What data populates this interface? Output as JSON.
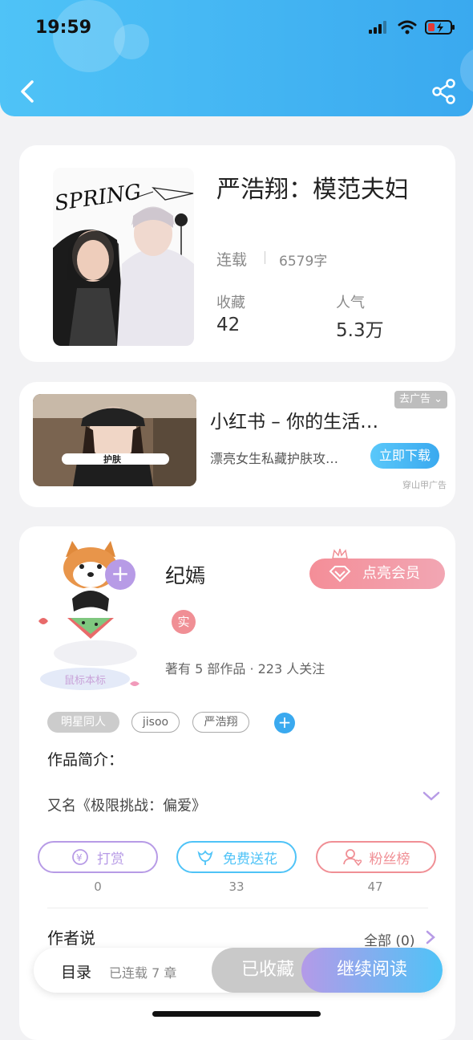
{
  "status_bar": {
    "time": "19:59"
  },
  "book": {
    "title": "严浩翔：模范夫妇",
    "status": "连载",
    "word_count": "6579字",
    "favorites_label": "收藏",
    "favorites_value": "42",
    "popularity_label": "人气",
    "popularity_value": "5.3万",
    "cover_text": "SPRING"
  },
  "ad": {
    "title": "小红书 – 你的生活…",
    "description": "漂亮女生私藏护肤攻…",
    "close_label": "去广告",
    "cta_label": "立即下载",
    "source": "穿山甲广告",
    "image_text": "护肤"
  },
  "author": {
    "name": "纪嫣",
    "vip_label": "点亮会员",
    "verified_label": "实",
    "meta": "著有 5 部作品 · 223 人关注",
    "avatar_badge": "鼠标本标",
    "tags": [
      "明星同人",
      "jisoo",
      "严浩翔"
    ],
    "intro_label": "作品简介：",
    "intro_text": "又名《极限挑战：偏爱》",
    "actions": [
      {
        "label": "打赏",
        "count": "0",
        "color": "#b79be6"
      },
      {
        "label": "免费送花",
        "count": "33",
        "color": "#4fc3f7"
      },
      {
        "label": "粉丝榜",
        "count": "47",
        "color": "#f08f95"
      }
    ],
    "author_say_label": "作者说",
    "author_say_all": "全部 (0)"
  },
  "bottom_bar": {
    "toc_label": "目录",
    "chapters": "已连载 7 章",
    "collected_label": "已收藏",
    "continue_label": "继续阅读"
  },
  "colors": {
    "accent": "#3aa9ef",
    "purple": "#b79be6",
    "pink": "#f08f95"
  }
}
